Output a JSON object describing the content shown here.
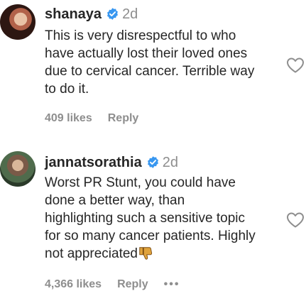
{
  "comments": [
    {
      "username": "shanaya",
      "time": "2d",
      "text": "This is very disrespectful to who\nhave actually lost their loved ones\ndue to cervical cancer. Terrible way\nto do it.",
      "likes": "409 likes",
      "reply_label": "Reply"
    },
    {
      "username": "jannatsorathia",
      "time": "2d",
      "text": "Worst PR Stunt, you could have\ndone a better way, than\nhighlighting such a sensitive topic\nfor so many cancer patients. Highly\nnot appreciated",
      "likes": "4,366 likes",
      "reply_label": "Reply",
      "more_label": "•••"
    }
  ],
  "icons": {
    "verified": "verified-badge-icon",
    "like": "heart-outline-icon",
    "emoji": "thumbs-down-emoji"
  },
  "colors": {
    "verified": "#3897f0",
    "muted": "#8e8e8e",
    "text": "#262626"
  }
}
